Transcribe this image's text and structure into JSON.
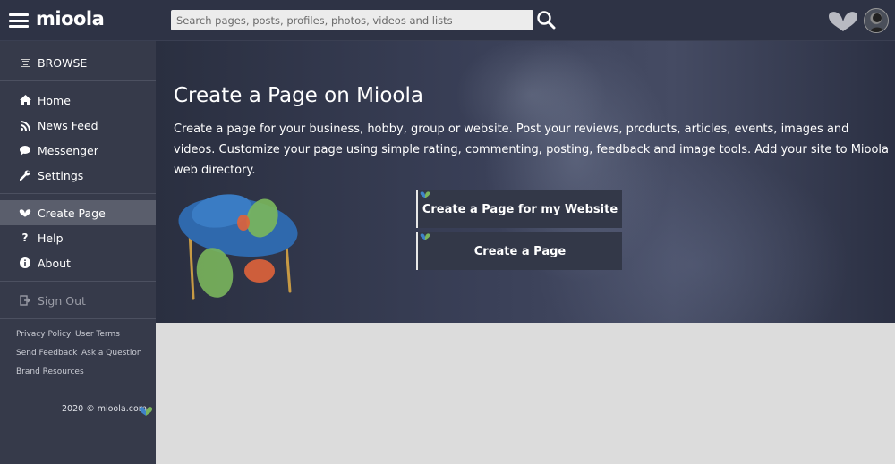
{
  "header": {
    "logo_text": "mioola",
    "search": {
      "placeholder": "Search pages, posts, profiles, photos, videos and lists",
      "value": ""
    },
    "brand_colors": {
      "green": "#7ab55c",
      "blue": "#3f83c8"
    }
  },
  "sidebar": {
    "browse_label": "BROWSE",
    "items": [
      {
        "label": "Home",
        "icon": "home-icon"
      },
      {
        "label": "News Feed",
        "icon": "rss-icon"
      },
      {
        "label": "Messenger",
        "icon": "chat-icon"
      },
      {
        "label": "Settings",
        "icon": "wrench-icon"
      },
      {
        "label": "Create Page",
        "icon": "heart-icon",
        "active": true
      },
      {
        "label": "Help",
        "icon": "question-icon"
      },
      {
        "label": "About",
        "icon": "info-icon"
      }
    ],
    "sign_out_label": "Sign Out",
    "footer_links": [
      "Privacy Policy",
      "User Terms",
      "Send Feedback",
      "Ask a Question",
      "Brand Resources"
    ],
    "copyright": "2020 © mioola.com"
  },
  "hero": {
    "title": "Create a Page on Mioola",
    "description": "Create a page for your business, hobby, group or website. Post your reviews, products, articles, events, images and videos. Customize your page using simple rating, commenting, posting, feedback and image tools. Add your site to Mioola web directory.",
    "buttons": [
      "Create a Page for my Website",
      "Create a Page"
    ]
  }
}
